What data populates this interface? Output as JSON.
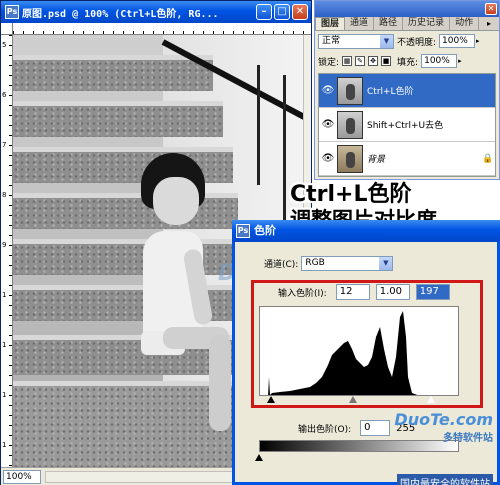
{
  "document": {
    "title": "原图.psd @ 100% (Ctrl+L色阶, RG...",
    "zoom": "100%",
    "watermark": "DuoTe.com",
    "ruler_left_labels": [
      "5",
      "6",
      "7",
      "8",
      "9",
      "1",
      "1",
      "1",
      "1"
    ]
  },
  "layers_panel": {
    "tabs": [
      "图层",
      "通道",
      "路径",
      "历史记录",
      "动作"
    ],
    "blend_mode": "正常",
    "opacity_label": "不透明度:",
    "opacity_value": "100%",
    "lock_label": "锁定:",
    "fill_label": "填充:",
    "fill_value": "100%",
    "layers": [
      {
        "name": "Ctrl+L色阶",
        "selected": true
      },
      {
        "name": "Shift+Ctrl+U去色",
        "selected": false
      },
      {
        "name": "背景",
        "selected": false
      }
    ]
  },
  "caption": {
    "line1": "Ctrl+L色阶",
    "line2": "调整图片对比度"
  },
  "levels_dialog": {
    "title": "色阶",
    "channel_label": "通道(C):",
    "channel_value": "RGB",
    "input_label": "输入色阶(I):",
    "input_black": "12",
    "input_gamma": "1.00",
    "input_white": "197",
    "output_label": "输出色阶(O):",
    "output_black": "0",
    "output_white": "255"
  },
  "site_watermark": {
    "logo": "DuoTe.com",
    "name": "多特软件站",
    "tag": "国内最安全的软件站"
  }
}
